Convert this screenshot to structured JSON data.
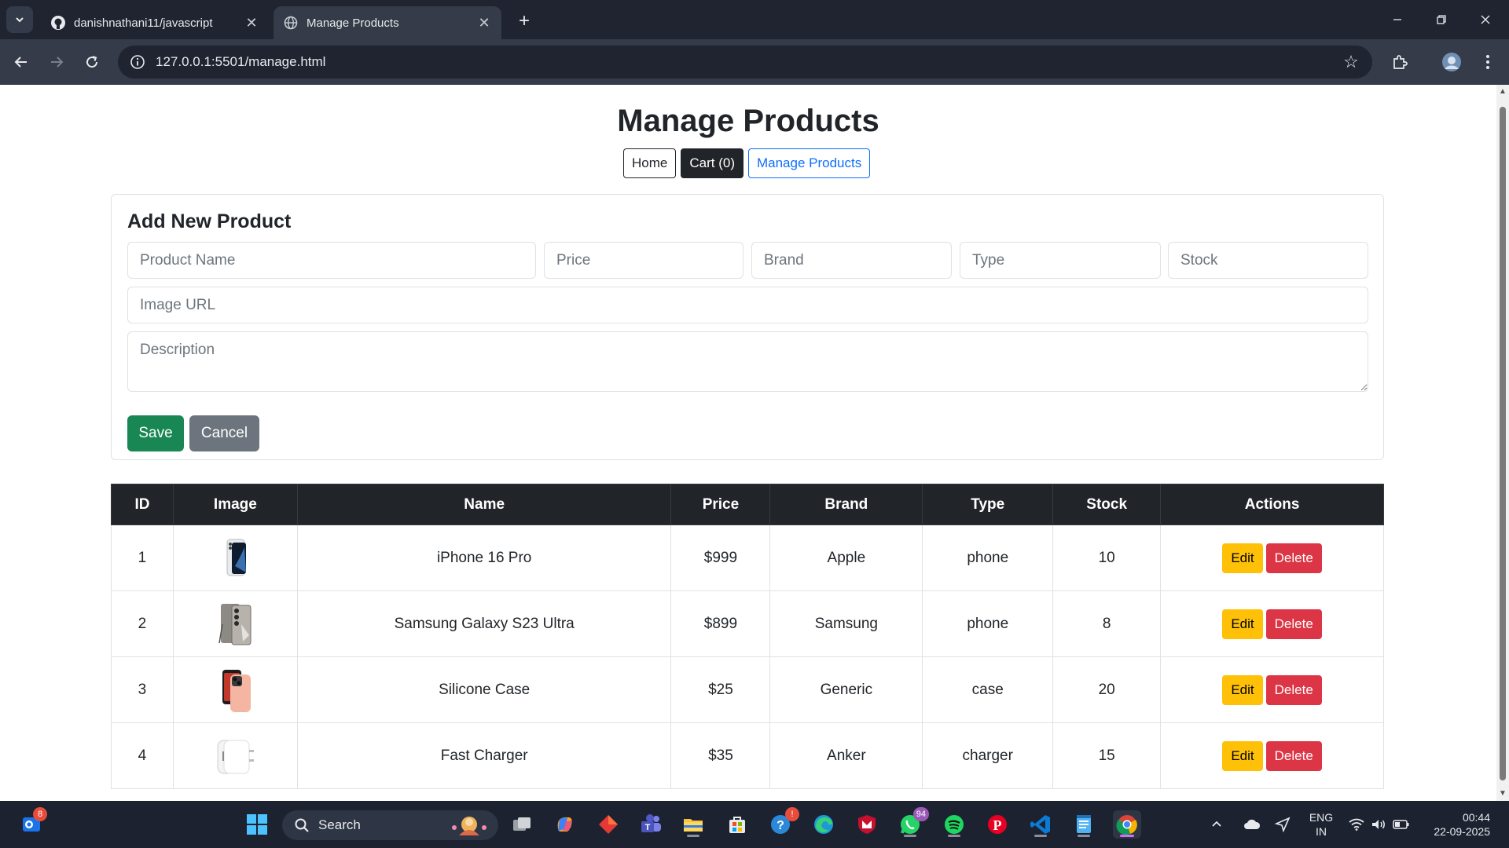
{
  "browser": {
    "tabs": [
      {
        "title": "danishnathani11/javascript",
        "icon": "github-icon",
        "active": false
      },
      {
        "title": "Manage Products",
        "icon": "globe-icon",
        "active": true
      }
    ],
    "url": "127.0.0.1:5501/manage.html"
  },
  "page": {
    "title": "Manage Products",
    "nav": {
      "home": "Home",
      "cart": "Cart (0)",
      "manage": "Manage Products"
    },
    "form": {
      "title": "Add New Product",
      "placeholders": {
        "name": "Product Name",
        "price": "Price",
        "brand": "Brand",
        "type": "Type",
        "stock": "Stock",
        "image": "Image URL",
        "description": "Description"
      },
      "save_label": "Save",
      "cancel_label": "Cancel"
    },
    "table": {
      "headers": [
        "ID",
        "Image",
        "Name",
        "Price",
        "Brand",
        "Type",
        "Stock",
        "Actions"
      ],
      "rows": [
        {
          "id": "1",
          "name": "iPhone 16 Pro",
          "price": "$999",
          "brand": "Apple",
          "type": "phone",
          "stock": "10"
        },
        {
          "id": "2",
          "name": "Samsung Galaxy S23 Ultra",
          "price": "$899",
          "brand": "Samsung",
          "type": "phone",
          "stock": "8"
        },
        {
          "id": "3",
          "name": "Silicone Case",
          "price": "$25",
          "brand": "Generic",
          "type": "case",
          "stock": "20"
        },
        {
          "id": "4",
          "name": "Fast Charger",
          "price": "$35",
          "brand": "Anker",
          "type": "charger",
          "stock": "15"
        }
      ],
      "edit_label": "Edit",
      "delete_label": "Delete"
    }
  },
  "taskbar": {
    "search_label": "Search",
    "outlook_badge": "8",
    "whatsapp_badge": "94",
    "help_badge": "!",
    "lang": "ENG",
    "region": "IN",
    "time": "00:44",
    "date": "22-09-2025"
  },
  "colors": {
    "success": "#198754",
    "secondary": "#6c757d",
    "warning": "#ffc107",
    "danger": "#dc3545",
    "primary": "#0d6efd",
    "dark": "#212529"
  }
}
